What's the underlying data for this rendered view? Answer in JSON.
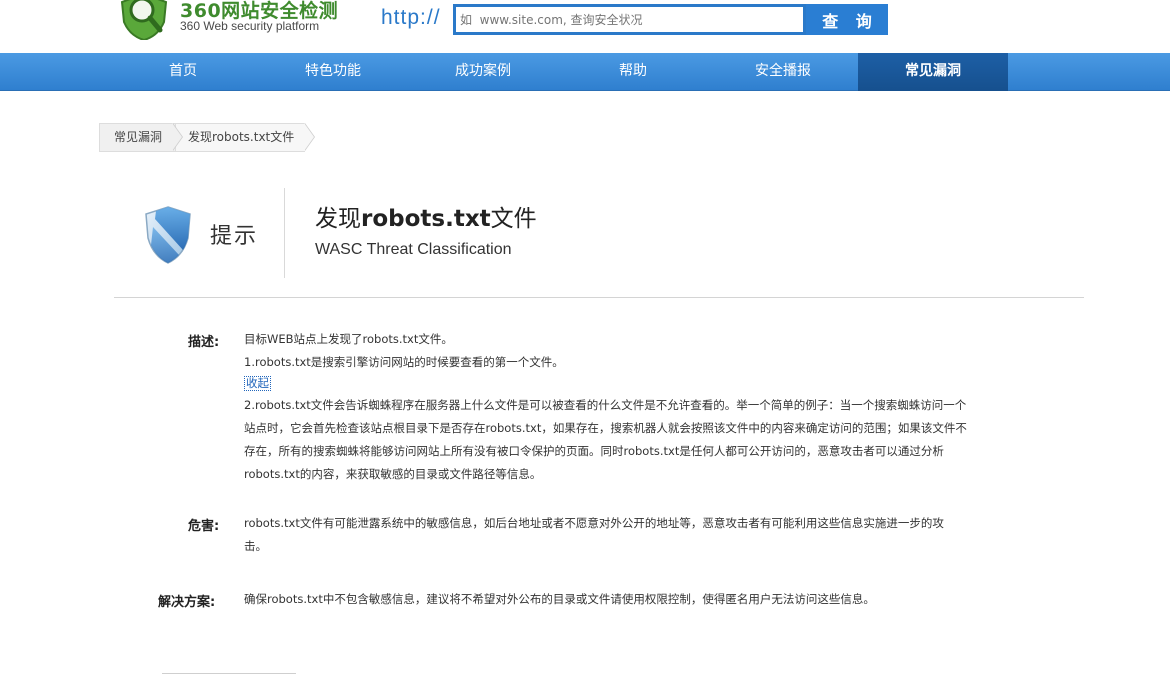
{
  "header": {
    "logo_title": "360网站安全检测",
    "logo_subtitle": "360 Web security platform",
    "http_label": "http://",
    "search_placeholder": "如  www.site.com, 查询安全状况",
    "search_button": "查 询"
  },
  "nav": {
    "items": [
      {
        "label": "首页"
      },
      {
        "label": "特色功能"
      },
      {
        "label": "成功案例"
      },
      {
        "label": "帮助"
      },
      {
        "label": "安全播报"
      },
      {
        "label": "常见漏洞"
      }
    ],
    "active": "常见漏洞"
  },
  "breadcrumb": {
    "items": [
      "常见漏洞",
      "发现robots.txt文件"
    ]
  },
  "title_block": {
    "tip_label": "提示",
    "vuln_title_prefix": "发现",
    "vuln_title_bold": "robots.txt",
    "vuln_title_suffix": "文件",
    "classification": "WASC Threat Classification"
  },
  "content": {
    "description_label": "描述:",
    "description_lines": [
      "目标WEB站点上发现了robots.txt文件。",
      "1.robots.txt是搜索引擎访问网站的时候要查看的第一个文件。"
    ],
    "collapse_link": "收起",
    "description_more": [
      "2.robots.txt文件会告诉蜘蛛程序在服务器上什么文件是可以被查看的什么文件是不允许查看的。举一个简单的例子：当一个搜索蜘蛛访问一个",
      "站点时，它会首先检查该站点根目录下是否存在robots.txt，如果存在，搜索机器人就会按照该文件中的内容来确定访问的范围；如果该文件不",
      "存在，所有的搜索蜘蛛将能够访问网站上所有没有被口令保护的页面。同时robots.txt是任何人都可公开访问的，恶意攻击者可以通过分析",
      "robots.txt的内容，来获取敏感的目录或文件路径等信息。"
    ],
    "harm_label": "危害:",
    "harm_lines": [
      "robots.txt文件有可能泄露系统中的敏感信息，如后台地址或者不愿意对外公开的地址等，恶意攻击者有可能利用这些信息实施进一步的攻",
      "击。"
    ],
    "fix_label": "解决方案:",
    "fix_text": "确保robots.txt中不包含敏感信息，建议将不希望对外公布的目录或文件请使用权限控制，使得匿名用户无法访问这些信息。"
  },
  "colors": {
    "brand_blue": "#2a79c9",
    "nav_active": "#16508e",
    "logo_green": "#3f8b2e"
  }
}
